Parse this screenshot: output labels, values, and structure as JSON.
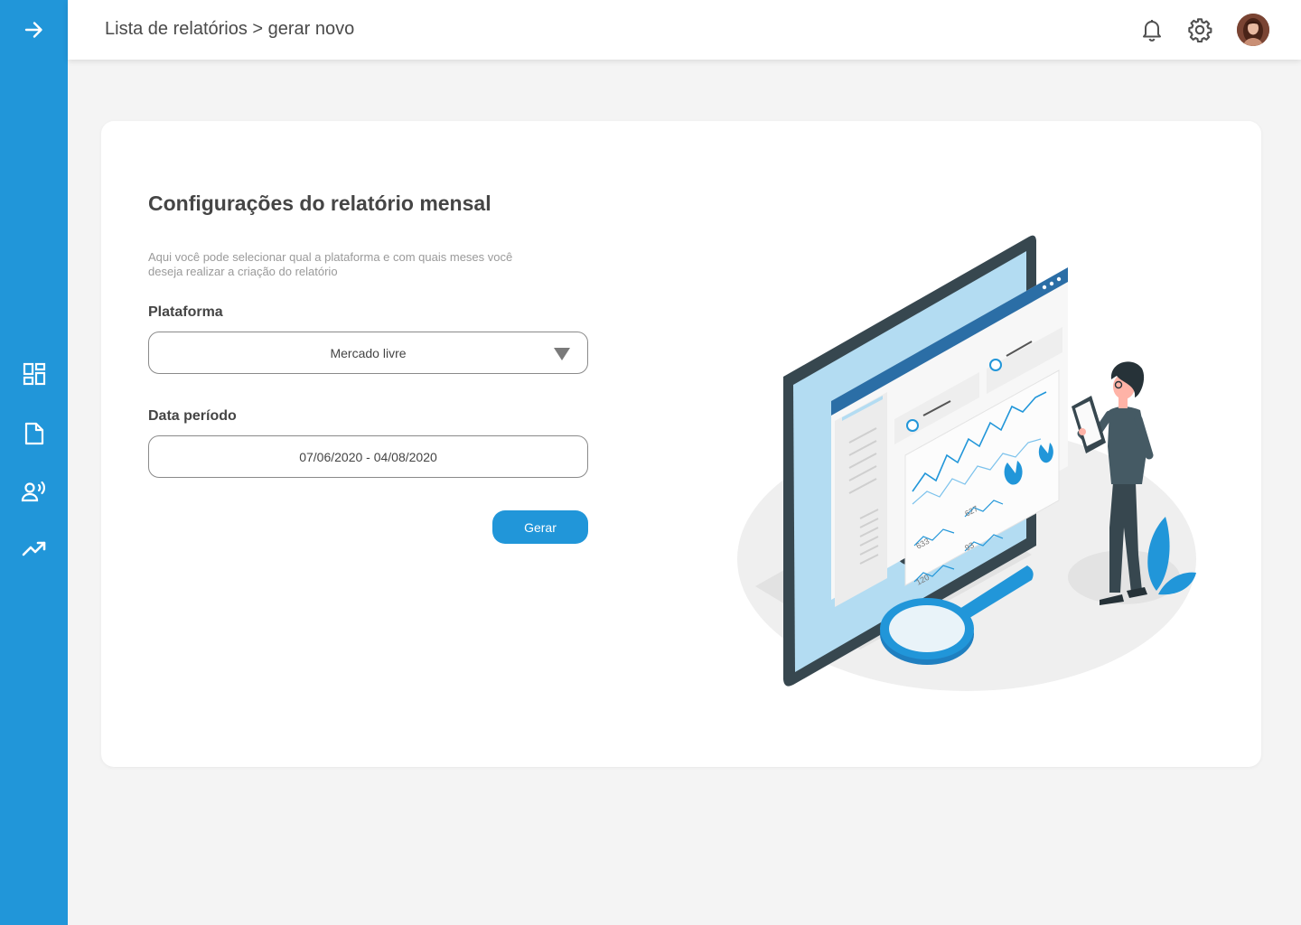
{
  "colors": {
    "primary": "#2196d9",
    "background": "#f4f4f4",
    "card": "#ffffff"
  },
  "sidebar": {
    "toggle_icon": "arrow-right-icon",
    "items": [
      {
        "id": "dashboard",
        "icon": "dashboard-icon"
      },
      {
        "id": "reports",
        "icon": "document-icon"
      },
      {
        "id": "voice",
        "icon": "record-voice-icon"
      },
      {
        "id": "trending",
        "icon": "trending-up-icon"
      }
    ]
  },
  "header": {
    "breadcrumb": "Lista de relatórios > gerar novo",
    "icons": [
      "bell-icon",
      "gear-icon",
      "avatar"
    ]
  },
  "form": {
    "title": "Configurações do relatório mensal",
    "description": "Aqui você pode selecionar qual a plataforma e com quais meses você deseja realizar a criação do relatório",
    "platform_label": "Plataforma",
    "platform_value": "Mercado livre",
    "period_label": "Data período",
    "period_value": "07/06/2020 - 04/08/2020",
    "submit_label": "Gerar"
  },
  "illustration": {
    "metric_labels": [
      "627",
      "633",
      "93",
      "120"
    ]
  }
}
